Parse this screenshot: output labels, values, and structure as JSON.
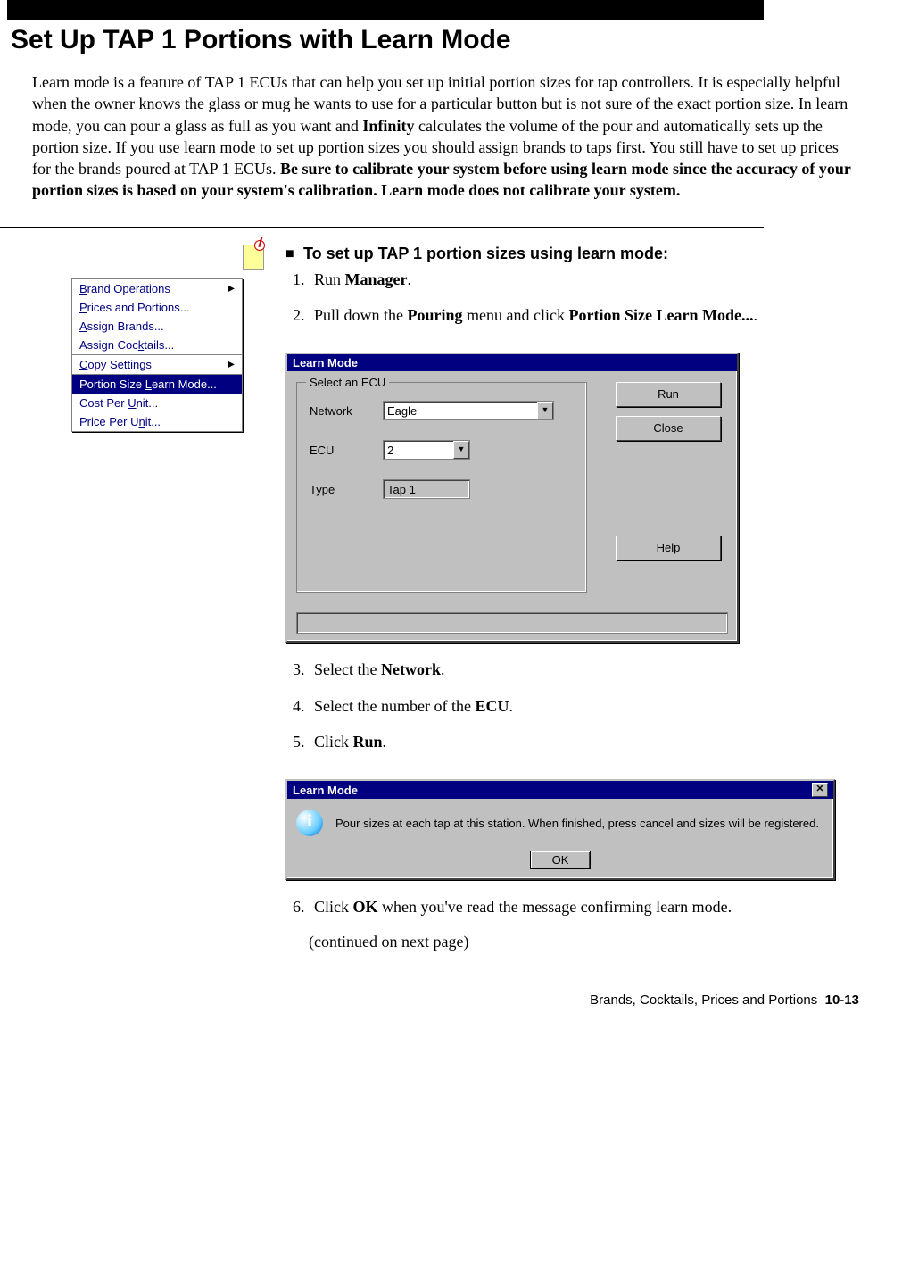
{
  "heading": "Set Up TAP 1 Portions with Learn Mode",
  "intro": {
    "t1": "Learn mode is a feature of TAP 1 ECUs that can help you set up initial portion sizes for tap controllers. It is especially helpful when the owner knows the glass or mug he wants to use for a particular button but is not sure of the exact portion size. In learn mode, you can pour a glass as full as you want and ",
    "b1": "Infinity",
    "t2": " calculates the volume of the pour and automatically sets up the portion size. If you use learn mode to set up portion sizes you should assign brands to taps first. You still have to set up prices for the brands poured at TAP 1 ECUs. ",
    "b2": "Be sure to calibrate your system before using learn mode since the accuracy of your portion sizes is based on your system's calibration. Learn mode does not calibrate your system."
  },
  "procedure_title": "To set up TAP 1 portion sizes using learn mode:",
  "steps": {
    "s1a": "Run ",
    "s1b": "Manager",
    "s1c": ".",
    "s2a": "Pull down the ",
    "s2b": "Pouring",
    "s2c": " menu and click ",
    "s2d": "Portion Size Learn Mode...",
    "s2e": ".",
    "s3a": "Select the ",
    "s3b": "Network",
    "s3c": ".",
    "s4a": "Select the number of the ",
    "s4b": "ECU",
    "s4c": ".",
    "s5a": "Click ",
    "s5b": "Run",
    "s5c": ".",
    "s6a": "Click ",
    "s6b": "OK",
    "s6c": " when you've read the message confirming learn mode."
  },
  "continued": "(continued on next page)",
  "menu": {
    "items": [
      "Brand Operations",
      "Prices and Portions...",
      "Assign Brands...",
      "Assign Cocktails...",
      "Copy Settings",
      "Portion Size Learn Mode...",
      "Cost Per Unit...",
      "Price Per Unit..."
    ]
  },
  "dialog1": {
    "title": "Learn Mode",
    "group_legend": "Select an ECU",
    "network_label": "Network",
    "network_value": "Eagle",
    "ecu_label": "ECU",
    "ecu_value": "2",
    "type_label": "Type",
    "type_value": "Tap 1",
    "run_btn": "Run",
    "close_btn": "Close",
    "help_btn": "Help"
  },
  "dialog2": {
    "title": "Learn Mode",
    "message": "Pour sizes at each tap at this station. When finished, press cancel and sizes will be registered.",
    "ok_btn": "OK"
  },
  "footer": {
    "section": "Brands, Cocktails, Prices and Portions",
    "page": "10-13"
  }
}
